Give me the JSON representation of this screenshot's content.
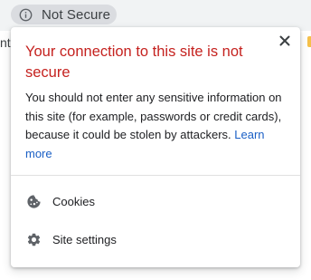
{
  "address_bar": {
    "security_chip": {
      "label": "Not Secure",
      "icon": "info-icon"
    },
    "background_text": "nt"
  },
  "popup": {
    "title": "Your connection to this site is not secure",
    "description": "You should not enter any sensitive information on this site (for example, passwords or credit cards), because it could be stolen by attackers.",
    "learn_more_label": "Learn more",
    "close_icon": "close-icon",
    "items": [
      {
        "label": "Cookies",
        "icon": "cookie-icon"
      },
      {
        "label": "Site settings",
        "icon": "gear-icon"
      }
    ]
  },
  "colors": {
    "warning_title": "#c5221f",
    "link": "#1a5fc5",
    "chip_background": "#dadce0"
  }
}
